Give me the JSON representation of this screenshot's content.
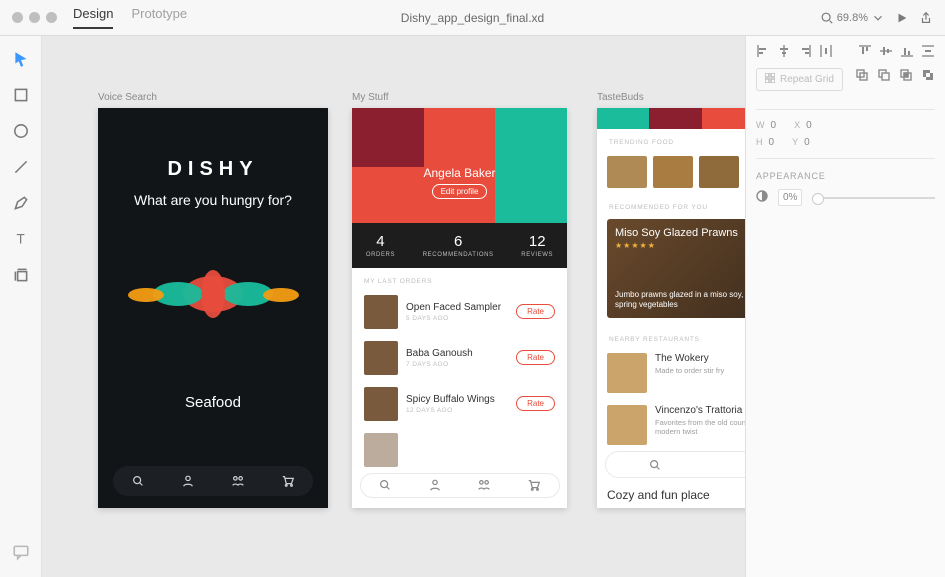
{
  "topbar": {
    "tabs": {
      "design": "Design",
      "prototype": "Prototype"
    },
    "filename": "Dishy_app_design_final.xd",
    "zoom": "69.8%"
  },
  "inspector": {
    "repeat_grid": "Repeat Grid",
    "w_label": "W",
    "w_val": "0",
    "x_label": "X",
    "x_val": "0",
    "h_label": "H",
    "h_val": "0",
    "y_label": "Y",
    "y_val": "0",
    "appearance": "APPEARANCE",
    "opacity": "0%"
  },
  "artboards": {
    "voice": {
      "label": "Voice Search",
      "brand": "DISHY",
      "question": "What are you hungry for?",
      "answer": "Seafood"
    },
    "mystuff": {
      "label": "My Stuff",
      "name": "Angela Baker",
      "edit": "Edit profile",
      "stats": [
        {
          "num": "4",
          "lbl": "ORDERS"
        },
        {
          "num": "6",
          "lbl": "RECOMMENDATIONS"
        },
        {
          "num": "12",
          "lbl": "REVIEWS"
        }
      ],
      "orders_head": "MY LAST ORDERS",
      "orders": [
        {
          "title": "Open Faced Sampler",
          "sub": "5 DAYS AGO",
          "btn": "Rate"
        },
        {
          "title": "Baba Ganoush",
          "sub": "7 DAYS AGO",
          "btn": "Rate"
        },
        {
          "title": "Spicy Buffalo Wings",
          "sub": "12 DAYS AGO",
          "btn": "Rate"
        }
      ]
    },
    "tastebuds": {
      "label": "TasteBuds",
      "hero_label": "TasteBuds",
      "trending": "TRENDING FOOD",
      "recommended": "RECOMMENDED FOR YOU",
      "feature_title": "Miso Soy Glazed Prawns",
      "feature_sub": "Jumbo prawns glazed in a miso soy, served with spring vegetables",
      "nearby": "NEARBY RESTAURANTS",
      "restaurants": [
        {
          "title": "The Wokery",
          "sub": "Made to order stir fry"
        },
        {
          "title": "Vincenzo's Trattoria",
          "sub": "Favorites from the old country with a modern twist"
        }
      ],
      "tail": "Cozy and fun place"
    }
  }
}
